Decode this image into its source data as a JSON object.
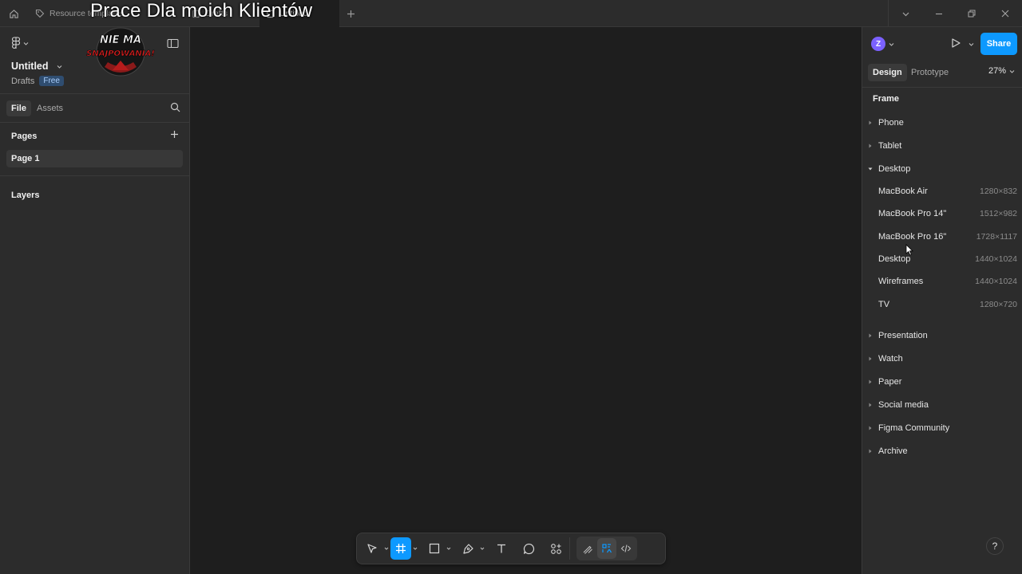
{
  "overlay": {
    "title": "Prace Dla moich Klientów"
  },
  "logo": {
    "line1": "NIE MA",
    "line2": "SNAJPOWANIA!"
  },
  "tabs": [
    {
      "label": "Resource templates"
    },
    {
      "label": "Drafts"
    },
    {
      "label": "Untitled"
    }
  ],
  "left": {
    "file_title": "Untitled",
    "file_location": "Drafts",
    "plan_badge": "Free",
    "tab_file": "File",
    "tab_assets": "Assets",
    "pages_label": "Pages",
    "page_1": "Page 1",
    "layers_label": "Layers"
  },
  "right": {
    "avatar_initial": "Z",
    "share_label": "Share",
    "tab_design": "Design",
    "tab_prototype": "Prototype",
    "zoom": "27%",
    "frame_label": "Frame",
    "categories_before": [
      "Phone",
      "Tablet"
    ],
    "expanded_category": "Desktop",
    "presets": [
      {
        "name": "MacBook Air",
        "size": "1280×832"
      },
      {
        "name": "MacBook Pro 14\"",
        "size": "1512×982"
      },
      {
        "name": "MacBook Pro 16\"",
        "size": "1728×1117"
      },
      {
        "name": "Desktop",
        "size": "1440×1024"
      },
      {
        "name": "Wireframes",
        "size": "1440×1024"
      },
      {
        "name": "TV",
        "size": "1280×720"
      }
    ],
    "categories_after": [
      "Presentation",
      "Watch",
      "Paper",
      "Social media",
      "Figma Community",
      "Archive"
    ],
    "help": "?"
  },
  "colors": {
    "accent": "#0d99ff",
    "panel": "#2c2c2c",
    "canvas": "#1e1e1e"
  },
  "icons": {
    "toolbar": [
      "move-icon",
      "frame-icon",
      "rectangle-icon",
      "pen-icon",
      "text-icon",
      "comment-icon",
      "actions-icon",
      "draw-mode-icon",
      "design-mode-icon",
      "dev-mode-icon"
    ]
  }
}
